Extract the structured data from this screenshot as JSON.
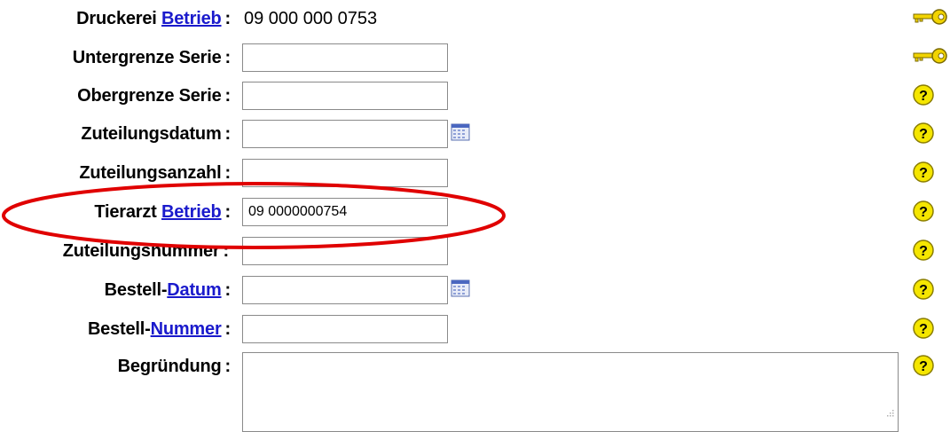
{
  "form": {
    "druckerei": {
      "label": "Druckerei",
      "link": "Betrieb",
      "value": "09 000 000 0753"
    },
    "untergrenze": {
      "label": "Untergrenze Serie",
      "value": ""
    },
    "obergrenze": {
      "label": "Obergrenze Serie",
      "value": ""
    },
    "zuteilungsdatum": {
      "label": "Zuteilungsdatum",
      "value": ""
    },
    "zuteilungsanzahl": {
      "label": "Zuteilungsanzahl",
      "value": ""
    },
    "tierarzt": {
      "label": "Tierarzt",
      "link": "Betrieb",
      "value": "09 0000000754"
    },
    "zuteilungsnummer": {
      "label": "Zuteilungsnummer",
      "value": ""
    },
    "bestell_datum": {
      "label": "Bestell-",
      "link": "Datum",
      "value": ""
    },
    "bestell_nummer": {
      "label": "Bestell-",
      "link": "Nummer",
      "value": ""
    },
    "begruendung": {
      "label": "Begründung",
      "value": ""
    },
    "colon": ":"
  },
  "icons": {
    "key": "key-icon",
    "help": "help-question-icon",
    "calendar": "calendar-icon",
    "help_glyph": "?"
  },
  "colors": {
    "link": "#1a1acc",
    "annotation": "#e00000",
    "help_yellow": "#f5e600"
  }
}
